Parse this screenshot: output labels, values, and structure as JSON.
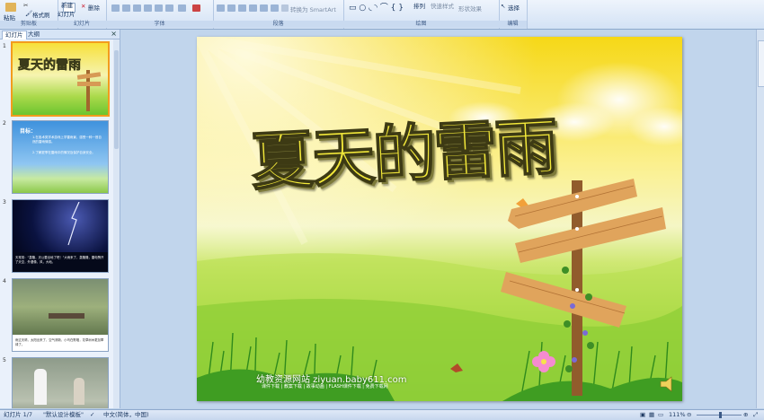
{
  "ribbon": {
    "clipboard": {
      "paste": "粘贴",
      "format_painter": "格式刷",
      "label": "剪贴板"
    },
    "slides": {
      "new_slide_line1": "新建",
      "new_slide_line2": "幻灯片",
      "delete": "删除",
      "label": "幻灯片"
    },
    "font": {
      "label": "字体"
    },
    "paragraph": {
      "label": "段落",
      "convert_smartart": "转换为 SmartArt"
    },
    "drawing": {
      "label": "绘图",
      "arrange": "排列",
      "quick_styles": "快速样式",
      "shape_effects": "形状效果"
    },
    "editing": {
      "label": "编辑",
      "select": "选择"
    }
  },
  "panel": {
    "tab_slides": "幻灯片",
    "tab_outline": "大纲",
    "close": "×",
    "thumbnails": [
      {
        "num": "1",
        "title": "夏天的雷雨"
      },
      {
        "num": "2",
        "heading": "目标：",
        "line1": "1.在各术类学术游戏上学雷雨景，感受一种一首自然的雷雨情感。",
        "line2": "2.了解夏季在雷雨中的情况及保护自身安全。"
      },
      {
        "num": "3",
        "caption": "天常常：“轰隆，天公要出地了吧！”大雨来了，轰隆隆，雷电劈开了天空，外婆像，风，大地。"
      },
      {
        "num": "4",
        "caption": "雨过天晴，太阳出来了，空气清新，小鸟在歌唱，花草树木更加翠绿了。"
      },
      {
        "num": "5"
      }
    ]
  },
  "slide": {
    "title": "夏天的雷雨",
    "watermark_line1": "幼教资源网站 ziyuan.baby611.com",
    "watermark_line2": "课件下载 | 教案下载 | 故事动画 | FLASH课件下载 | 免费下载网"
  },
  "status": {
    "slide_counter": "幻灯片 1/7",
    "theme": "\"默认设计模板\"",
    "language": "中文(简体，中国)",
    "zoom": "111%"
  },
  "colors": {
    "title_yellow": "#f3e93a",
    "accent_orange": "#f39c1d",
    "ribbon_bg": "#d3e2f5"
  }
}
